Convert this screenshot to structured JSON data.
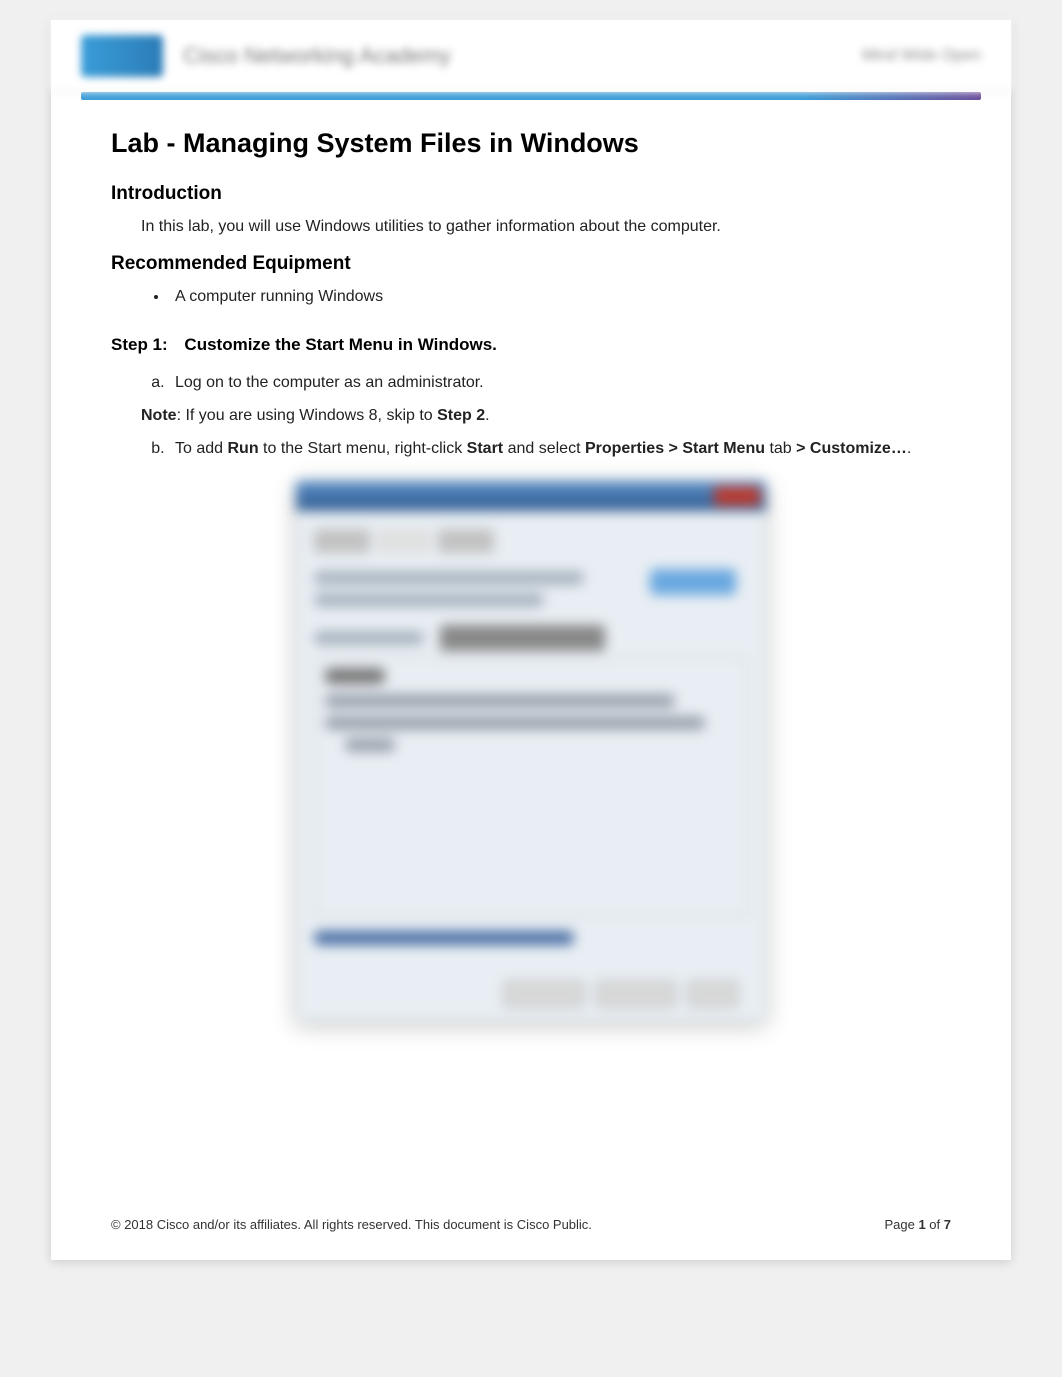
{
  "header": {
    "brand_text": "Cisco Networking Academy",
    "right_text": "Mind Wide Open"
  },
  "doc_title": "Lab - Managing System Files in Windows",
  "intro": {
    "heading": "Introduction",
    "text": "In this lab, you will use Windows utilities to gather information about the computer."
  },
  "equipment": {
    "heading": "Recommended Equipment",
    "items": [
      "A computer running Windows"
    ]
  },
  "step1": {
    "label": "Step 1:",
    "title": "Customize the Start Menu in Windows.",
    "item_a": "Log on to the computer as an administrator.",
    "note": {
      "label": "Note",
      "text_1": ": If you are using Windows 8, skip to ",
      "bold": "Step 2",
      "text_2": "."
    },
    "item_b": {
      "t1": "To add ",
      "b1": "Run",
      "t2": " to the Start menu, right-click ",
      "b2": "Start",
      "t3": " and select ",
      "b3": "Properties > Start Menu",
      "t4": " tab ",
      "b4": "> Customize…",
      "t5": "."
    }
  },
  "footer": {
    "copyright": "© 2018 Cisco and/or its affiliates. All rights reserved. This document is Cisco Public.",
    "page_label": "Page ",
    "page_current": "1",
    "page_of": " of ",
    "page_total": "7"
  }
}
